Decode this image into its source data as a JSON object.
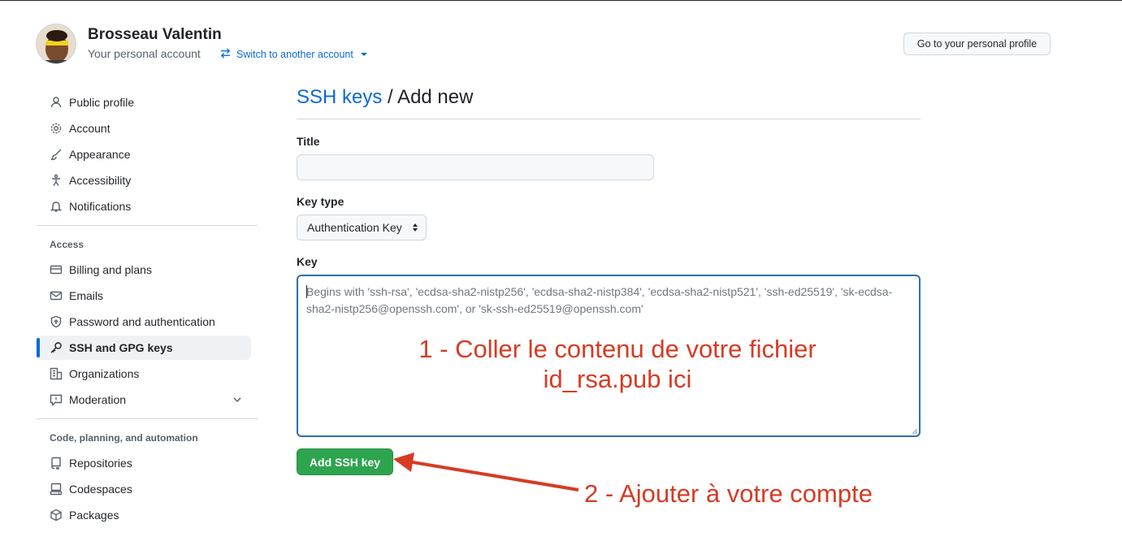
{
  "header": {
    "user_name": "Brosseau Valentin",
    "account_subtitle": "Your personal account",
    "switch_label": "Switch to another account",
    "profile_button": "Go to your personal profile"
  },
  "sidebar": {
    "top_items": [
      {
        "label": "Public profile",
        "icon": "person-icon"
      },
      {
        "label": "Account",
        "icon": "gear-icon"
      },
      {
        "label": "Appearance",
        "icon": "paintbrush-icon"
      },
      {
        "label": "Accessibility",
        "icon": "accessibility-icon"
      },
      {
        "label": "Notifications",
        "icon": "bell-icon"
      }
    ],
    "access_heading": "Access",
    "access_items": [
      {
        "label": "Billing and plans",
        "icon": "credit-card-icon"
      },
      {
        "label": "Emails",
        "icon": "mail-icon"
      },
      {
        "label": "Password and authentication",
        "icon": "shield-lock-icon"
      },
      {
        "label": "SSH and GPG keys",
        "icon": "key-icon",
        "selected": true
      },
      {
        "label": "Organizations",
        "icon": "organization-icon"
      },
      {
        "label": "Moderation",
        "icon": "report-icon"
      }
    ],
    "code_heading": "Code, planning, and automation",
    "code_items": [
      {
        "label": "Repositories",
        "icon": "repo-icon"
      },
      {
        "label": "Codespaces",
        "icon": "codespaces-icon"
      },
      {
        "label": "Packages",
        "icon": "package-icon"
      }
    ]
  },
  "main": {
    "breadcrumb_link": "SSH keys",
    "breadcrumb_current": "/ Add new",
    "title_label": "Title",
    "title_value": "",
    "key_type_label": "Key type",
    "key_type_value": "Authentication Key",
    "key_label": "Key",
    "key_placeholder": "Begins with 'ssh-rsa', 'ecdsa-sha2-nistp256', 'ecdsa-sha2-nistp384', 'ecdsa-sha2-nistp521', 'ssh-ed25519', 'sk-ecdsa-sha2-nistp256@openssh.com', or 'sk-ssh-ed25519@openssh.com'",
    "submit_label": "Add SSH key"
  },
  "annotations": {
    "step1_line1": "1 - Coller le contenu de votre fichier",
    "step1_line2": "id_rsa.pub ici",
    "step2": "2 - Ajouter à votre compte",
    "color": "#d63b24"
  },
  "colors": {
    "link": "#0969da",
    "primary_button": "#2da44e",
    "selected_indicator": "#0969da"
  }
}
